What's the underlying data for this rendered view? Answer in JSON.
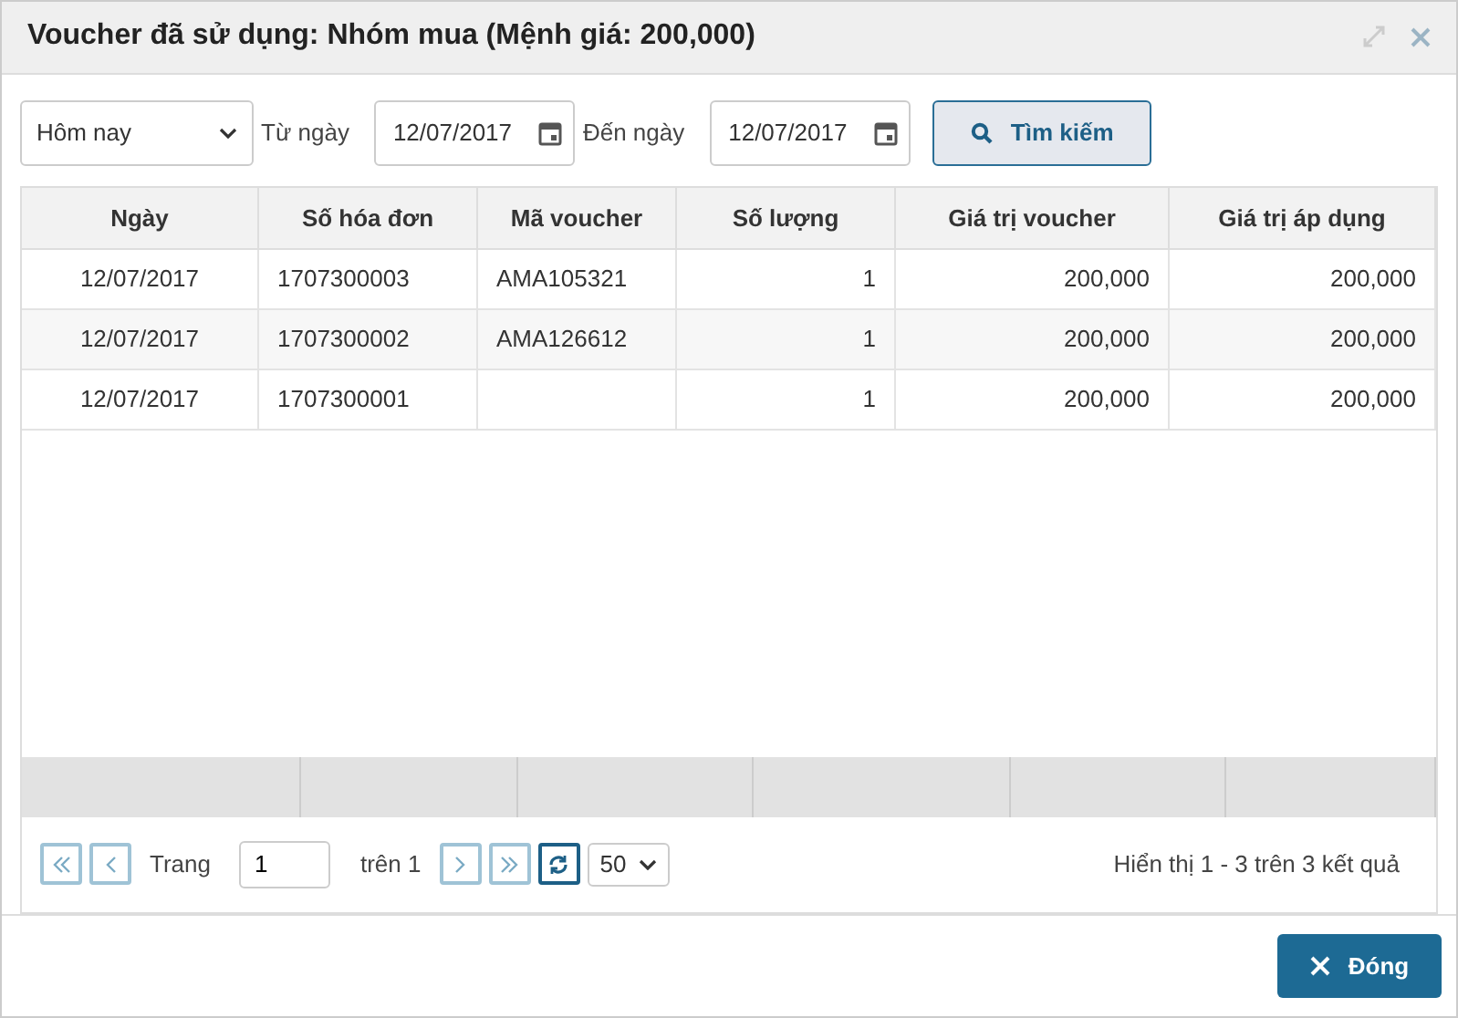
{
  "window": {
    "title": "Voucher đã sử dụng: Nhóm mua (Mệnh giá: 200,000)"
  },
  "filter": {
    "period": "Hôm nay",
    "from_label": "Từ ngày",
    "from_date": "12/07/2017",
    "to_label": "Đến ngày",
    "to_date": "12/07/2017",
    "search_button": "Tìm kiếm"
  },
  "table": {
    "columns": [
      {
        "label": "Ngày"
      },
      {
        "label": "Số hóa đơn"
      },
      {
        "label": "Mã voucher"
      },
      {
        "label": "Số lượng"
      },
      {
        "label": "Giá trị voucher"
      },
      {
        "label": "Giá trị áp dụng"
      }
    ],
    "rows": [
      [
        "12/07/2017",
        "1707300003",
        "AMA105321",
        "1",
        "200,000",
        "200,000"
      ],
      [
        "12/07/2017",
        "1707300002",
        "AMA126612",
        "1",
        "200,000",
        "200,000"
      ],
      [
        "12/07/2017",
        "1707300001",
        "",
        "1",
        "200,000",
        "200,000"
      ]
    ]
  },
  "pager": {
    "page_label": "Trang",
    "page": "1",
    "of_label": "trên 1",
    "page_size": "50",
    "summary": "Hiển thị 1 - 3 trên 3 kết quả"
  },
  "close_button": "Đóng"
}
